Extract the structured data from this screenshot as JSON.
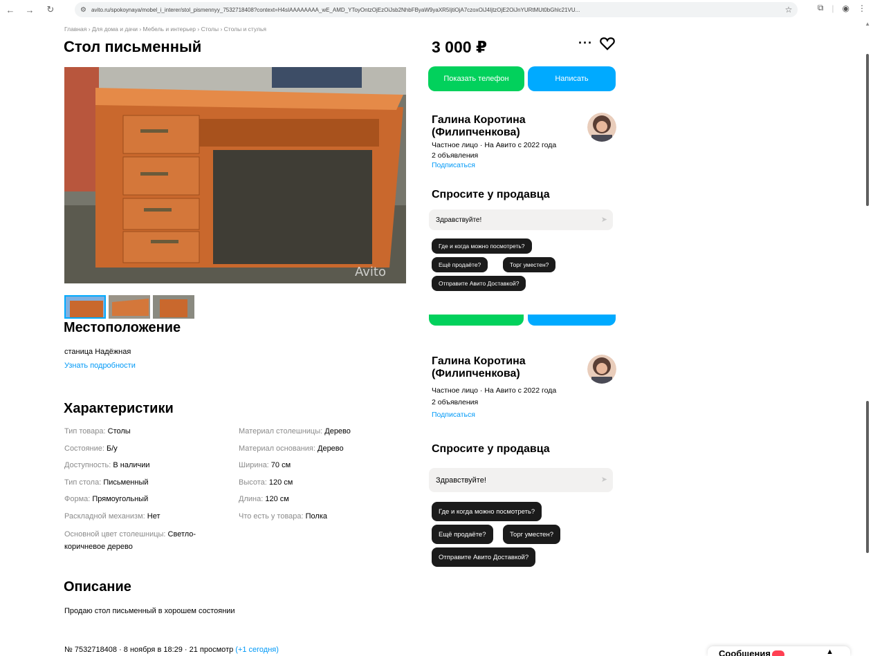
{
  "browser": {
    "url": "avito.ru/spokoynaya/mobel_i_interer/stol_pismennyy_7532718408?context=H4sIAAAAAAAA_wE_AMD_YToyOntzOjEzOiJsb2NhbFByaW9yaXR5IjtiOjA7czoxOiJ4IjtzOjE2OiJnYURtMUt0bGhlc21VU..."
  },
  "breadcrumb": "Главная › Для дома и дачи › Мебель и интерьер › Столы › Столы и стулья",
  "listing": {
    "title": "Стол письменный",
    "price": "3 000 ₽",
    "photos_count": 3,
    "active_photo": 1
  },
  "location": {
    "heading": "Местоположение",
    "place": "станица Надёжная",
    "details_link": "Узнать подробности"
  },
  "characteristics": {
    "heading": "Характеристики",
    "left": [
      {
        "name": "Тип товара: ",
        "value": "Столы"
      },
      {
        "name": "Состояние: ",
        "value": "Б/у"
      },
      {
        "name": "Доступность: ",
        "value": "В наличии"
      },
      {
        "name": "Тип стола: ",
        "value": "Письменный"
      },
      {
        "name": "Форма: ",
        "value": "Прямоугольный"
      },
      {
        "name": "Раскладной механизм: ",
        "value": "Нет"
      },
      {
        "name": "Основной цвет столешницы: ",
        "value": "Светло-коричневое дерево"
      }
    ],
    "right": [
      {
        "name": "Материал столешницы: ",
        "value": "Дерево"
      },
      {
        "name": "Материал основания: ",
        "value": "Дерево"
      },
      {
        "name": "Ширина: ",
        "value": "70 см"
      },
      {
        "name": "Высота: ",
        "value": "120 см"
      },
      {
        "name": "Длина: ",
        "value": "120 см"
      },
      {
        "name": "Что есть у товара: ",
        "value": "Полка"
      }
    ]
  },
  "description": {
    "heading": "Описание",
    "text": "Продаю стол письменный в хорошем состоянии"
  },
  "footer_meta": {
    "text": "№ 7532718408 · 8 ноября в 18:29 · 21 просмотр ",
    "today": "(+1 сегодня)"
  },
  "actions": {
    "show_phone": "Показать телефон",
    "write": "Написать"
  },
  "seller": {
    "name": "Галина Коротина (Филипченкова)",
    "type_line": "Частное лицо · На Авито с 2022 года",
    "ads_count": "2 объявления",
    "subscribe": "Подписаться"
  },
  "ask": {
    "heading": "Спросите у продавца",
    "input_value": "Здравствуйте!",
    "chips": [
      "Где и когда можно посмотреть?",
      "Ещё продаёте?",
      "Торг уместен?",
      "Отправите Авито Доставкой?"
    ]
  },
  "messages_tab": {
    "label": "Сообщения"
  },
  "colors": {
    "green": "#02d15c",
    "blue": "#00aaff",
    "link": "#0099f7",
    "chip": "#1b1b1b"
  }
}
